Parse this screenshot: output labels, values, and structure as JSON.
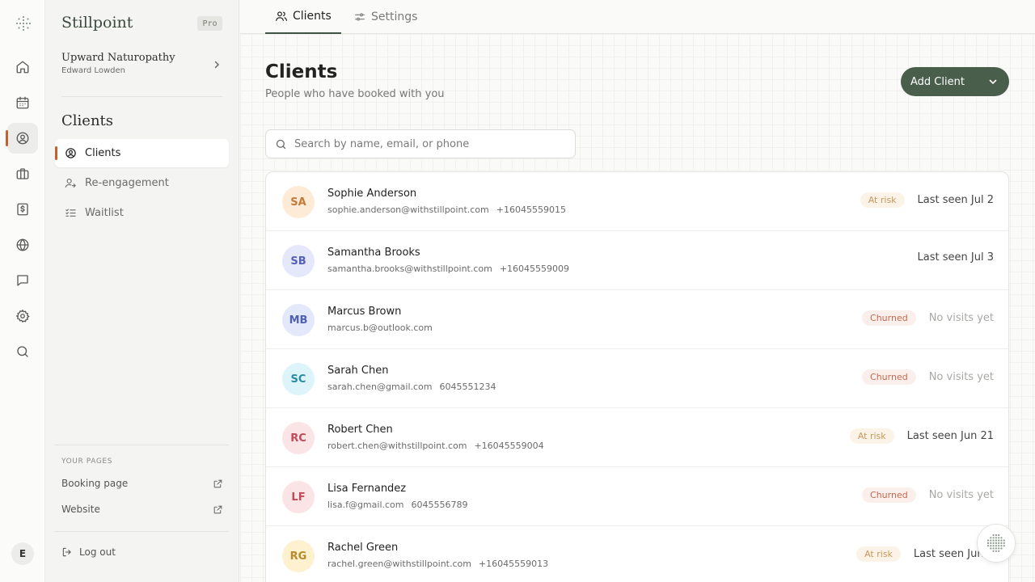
{
  "brand": {
    "name": "Stillpoint",
    "plan": "Pro"
  },
  "practice": {
    "name": "Upward Naturopathy",
    "owner": "Edward Lowden"
  },
  "sidebar": {
    "section_title": "Clients",
    "items": [
      {
        "label": "Clients",
        "icon": "user-circle-icon",
        "active": true
      },
      {
        "label": "Re-engagement",
        "icon": "user-refresh-icon",
        "active": false
      },
      {
        "label": "Waitlist",
        "icon": "list-check-icon",
        "active": false
      }
    ],
    "pages_label": "YOUR PAGES",
    "pages": [
      {
        "label": "Booking page",
        "icon": "external-link-icon"
      },
      {
        "label": "Website",
        "icon": "external-link-icon"
      }
    ],
    "logout_label": "Log out"
  },
  "rail": {
    "icons": [
      "home-icon",
      "calendar-icon",
      "users-icon",
      "briefcase-icon",
      "invoice-icon",
      "globe-icon",
      "message-icon",
      "gear-icon",
      "search-icon"
    ],
    "active": "users-icon",
    "user_initial": "E"
  },
  "tabs": [
    {
      "label": "Clients",
      "icon": "users-icon",
      "active": true
    },
    {
      "label": "Settings",
      "icon": "sliders-icon",
      "active": false
    }
  ],
  "header": {
    "title": "Clients",
    "subtitle": "People who have booked with you",
    "add_button": "Add Client"
  },
  "search": {
    "placeholder": "Search by name, email, or phone",
    "value": ""
  },
  "clients": [
    {
      "initials": "SA",
      "name": "Sophie Anderson",
      "email": "sophie.anderson@withstillpoint.com",
      "phone": "+16045559015",
      "status": "At risk",
      "status_type": "atrisk",
      "last_seen": "Last seen Jul 2",
      "avatar_bg": "#fdebd8",
      "avatar_fg": "#c47a3a"
    },
    {
      "initials": "SB",
      "name": "Samantha Brooks",
      "email": "samantha.brooks@withstillpoint.com",
      "phone": "+16045559009",
      "status": "",
      "status_type": "",
      "last_seen": "Last seen Jul 3",
      "avatar_bg": "#e5e8fb",
      "avatar_fg": "#5561b5"
    },
    {
      "initials": "MB",
      "name": "Marcus Brown",
      "email": "marcus.b@outlook.com",
      "phone": "",
      "status": "Churned",
      "status_type": "churned",
      "last_seen": "No visits yet",
      "avatar_bg": "#e3e8fb",
      "avatar_fg": "#4f5fb3"
    },
    {
      "initials": "SC",
      "name": "Sarah Chen",
      "email": "sarah.chen@gmail.com",
      "phone": "6045551234",
      "status": "Churned",
      "status_type": "churned",
      "last_seen": "No visits yet",
      "avatar_bg": "#dcf4fa",
      "avatar_fg": "#2c8aa6"
    },
    {
      "initials": "RC",
      "name": "Robert Chen",
      "email": "robert.chen@withstillpoint.com",
      "phone": "+16045559004",
      "status": "At risk",
      "status_type": "atrisk",
      "last_seen": "Last seen Jun 21",
      "avatar_bg": "#fbe4e6",
      "avatar_fg": "#c04a5a"
    },
    {
      "initials": "LF",
      "name": "Lisa Fernandez",
      "email": "lisa.f@gmail.com",
      "phone": "6045556789",
      "status": "Churned",
      "status_type": "churned",
      "last_seen": "No visits yet",
      "avatar_bg": "#fbe4e6",
      "avatar_fg": "#c04a5a"
    },
    {
      "initials": "RG",
      "name": "Rachel Green",
      "email": "rachel.green@withstillpoint.com",
      "phone": "+16045559013",
      "status": "At risk",
      "status_type": "atrisk",
      "last_seen": "Last seen Jun 2",
      "avatar_bg": "#fdf1cf",
      "avatar_fg": "#b9892a"
    }
  ],
  "colors": {
    "accent": "#4a5e4c",
    "active_marker": "#c1612f",
    "at_risk": "#c9975a",
    "churned": "#c5694f"
  }
}
